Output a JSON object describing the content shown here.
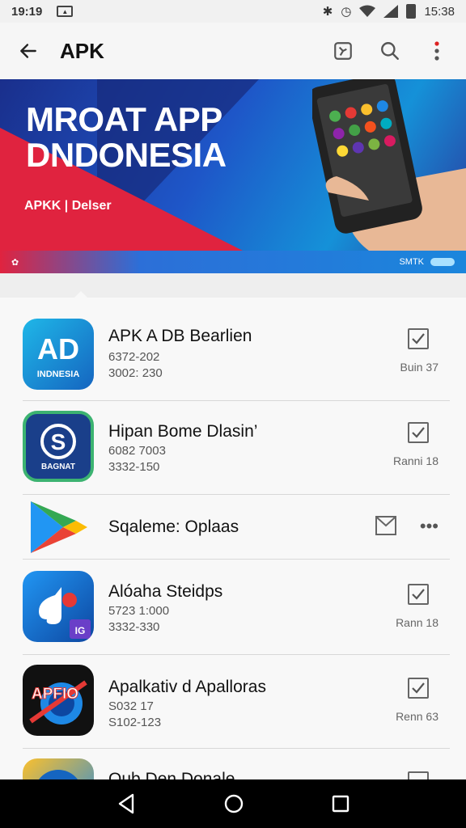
{
  "status_bar": {
    "time": "19:19",
    "clock_right": "15:38"
  },
  "app_bar": {
    "title": "APK"
  },
  "banner": {
    "headline_line1": "MROAT APP",
    "headline_line2": "DNDONESIA",
    "sub": "APKK | Delser",
    "strip_right": "SMTK"
  },
  "apps": [
    {
      "name": "APK A DB Bearlien",
      "meta1": "6372-202",
      "meta2": "3002: 230",
      "status": "Buin 37",
      "icon_text": "AD",
      "icon_sub": "INDNESIA"
    },
    {
      "name": "Hipan Bome Dlasin’",
      "meta1": "6082 7003",
      "meta2": "3332-150",
      "status": "Ranni 18",
      "icon_text": "S",
      "icon_sub": "BAGNAT"
    },
    {
      "name": "Sqaleme: Oplaas",
      "meta1": "",
      "meta2": "",
      "status": "",
      "icon_text": "",
      "icon_sub": ""
    },
    {
      "name": "Alóaha Steidps",
      "meta1": "5723 1:000",
      "meta2": "3332-330",
      "status": "Rann 18",
      "icon_text": "",
      "icon_sub": "IG"
    },
    {
      "name": "Apalkativ d Apalloras",
      "meta1": "S032 17",
      "meta2": "S102-123",
      "status": "Renn 63",
      "icon_text": "APFIO",
      "icon_sub": ""
    },
    {
      "name": "Oub Den Donale",
      "meta1": "",
      "meta2": "",
      "status": "",
      "icon_text": "",
      "icon_sub": ""
    }
  ]
}
